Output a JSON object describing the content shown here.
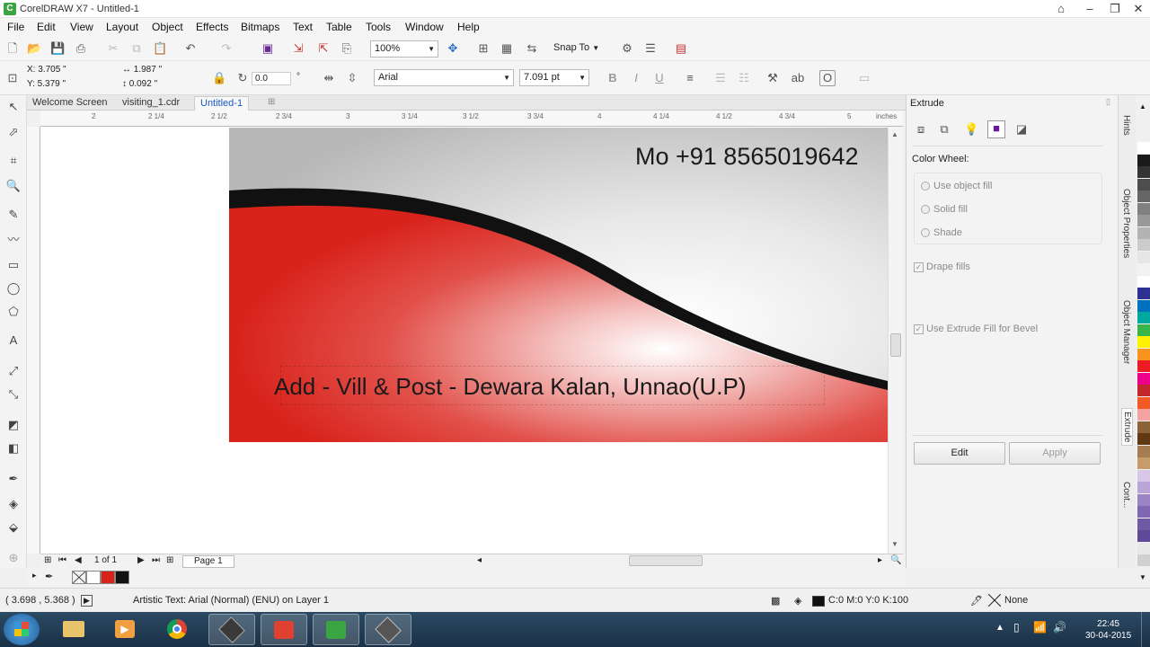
{
  "window": {
    "title": "CorelDRAW X7 - Untitled-1"
  },
  "menu": [
    "File",
    "Edit",
    "View",
    "Layout",
    "Object",
    "Effects",
    "Bitmaps",
    "Text",
    "Table",
    "Tools",
    "Window",
    "Help"
  ],
  "toolbar": {
    "zoom": "100%",
    "snap_to": "Snap To"
  },
  "property_bar": {
    "x": "X: 3.705 \"",
    "y": "Y: 5.379 \"",
    "w": "1.987 \"",
    "h": "0.092 \"",
    "rotation": "0.0",
    "degree": "°",
    "font": "Arial",
    "font_size": "7.091 pt"
  },
  "tabs": [
    "Welcome Screen",
    "visiting_1.cdr",
    "Untitled-1"
  ],
  "ruler": {
    "labels": [
      "2",
      "2 1/4",
      "2 1/2",
      "2 3/4",
      "3",
      "3 1/4",
      "3 1/2",
      "3 3/4",
      "4",
      "4 1/4",
      "4 1/2",
      "4 3/4",
      "5"
    ],
    "unit": "inches"
  },
  "card": {
    "phone": "Mo +91 8565019642",
    "address": "Add - Vill & Post - Dewara Kalan, Unnao(U.P)",
    "colors": {
      "red": "#d8231b",
      "band": "#111111",
      "grey": "#c8c8c8"
    }
  },
  "pages": {
    "counter": "1 of 1",
    "page_tab": "Page 1"
  },
  "status": {
    "cursor": "( 3.698 , 5.368 )",
    "object_info": "Artistic Text: Arial (Normal) (ENU) on Layer 1",
    "fill": "C:0 M:0 Y:0 K:100",
    "outline": "None"
  },
  "docker": {
    "title": "Extrude",
    "color_wheel": "Color Wheel:",
    "use_object_fill": "Use object fill",
    "solid_fill": "Solid fill",
    "shade": "Shade",
    "drape_fills": "Drape fills",
    "use_extrude_fill_bevel": "Use Extrude Fill for Bevel",
    "edit": "Edit",
    "apply": "Apply"
  },
  "side_tabs": [
    "Hints",
    "Object Properties",
    "Object Manager",
    "Extrude",
    "Cont..."
  ],
  "palette": [
    "#ffffff",
    "#1a1a1a",
    "#333333",
    "#4d4d4d",
    "#666666",
    "#808080",
    "#999999",
    "#b3b3b3",
    "#cccccc",
    "#e6e6e6",
    "#f2f2f2",
    "#ffffff",
    "#2e3192",
    "#0071bc",
    "#00a99d",
    "#39b54a",
    "#fff200",
    "#f7941d",
    "#ed1c24",
    "#ec008c",
    "#c1272d",
    "#f15a24",
    "#f4a3a3",
    "#8c6239",
    "#603813",
    "#a67c52",
    "#c69c6d",
    "#d7c7e7",
    "#b9a5d6",
    "#9b84c4",
    "#7f67b1",
    "#6f5aa6",
    "#5d4a99",
    "#e8e8e8",
    "#d0d0d0"
  ],
  "colorstrip": [
    "#ffffff",
    "#d8231b",
    "#111111"
  ],
  "clock": {
    "time": "22:45",
    "date": "30-04-2015"
  }
}
